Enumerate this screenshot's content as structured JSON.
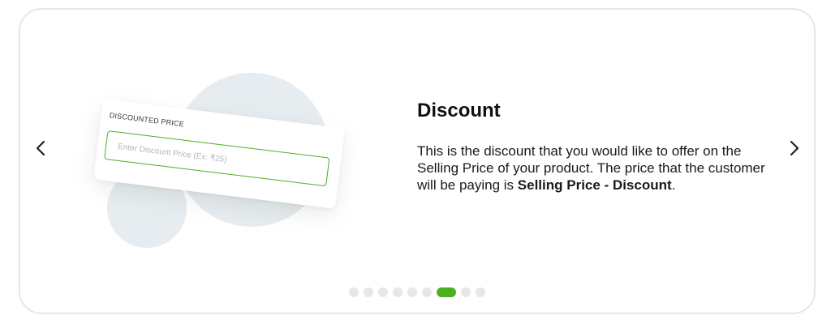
{
  "slide": {
    "title": "Discount",
    "description_part1": "This is the discount that you would like to offer on the Selling Price of your product. The price that the customer will be paying is ",
    "description_bold": "Selling Price - Discount",
    "description_part2": "."
  },
  "illustration": {
    "field_label": "DISCOUNTED PRICE",
    "field_placeholder": "Enter Discount Price (Ex: ₹25)"
  },
  "navigation": {
    "prev_icon": "chevron-left-icon",
    "next_icon": "chevron-right-icon"
  },
  "pagination": {
    "total": 9,
    "active_index": 6
  },
  "colors": {
    "accent": "#4caf20",
    "dot_inactive": "#e4e8ea",
    "circle": "#e6ecef",
    "border": "#e3e8ea"
  }
}
